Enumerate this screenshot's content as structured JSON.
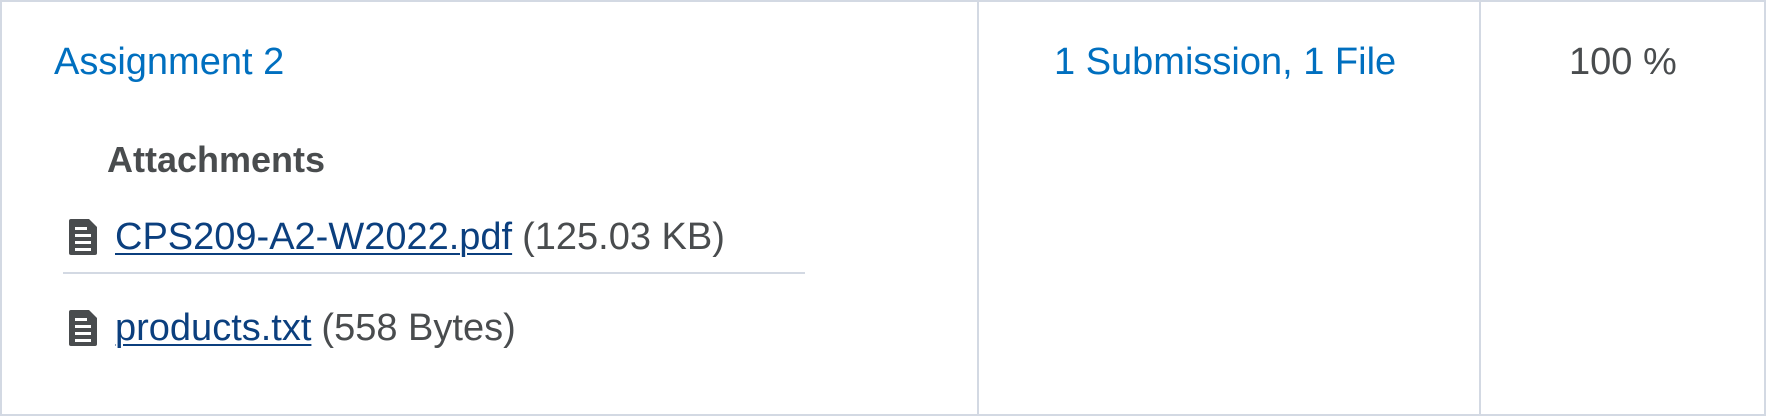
{
  "assignment": {
    "name": "Assignment 2",
    "attachments_heading": "Attachments",
    "attachments": [
      {
        "file_name": "CPS209-A2-W2022.pdf",
        "size": "(125.03 KB)",
        "icon": "file-document-icon"
      },
      {
        "file_name": "products.txt",
        "size": "(558 Bytes)",
        "icon": "file-document-icon"
      }
    ],
    "submissions": "1 Submission, 1 File",
    "score": "100 %"
  },
  "colors": {
    "link": "#006fbf",
    "file_link": "#0b3f7e",
    "text": "#494c4e",
    "border": "#d3d9e3"
  }
}
